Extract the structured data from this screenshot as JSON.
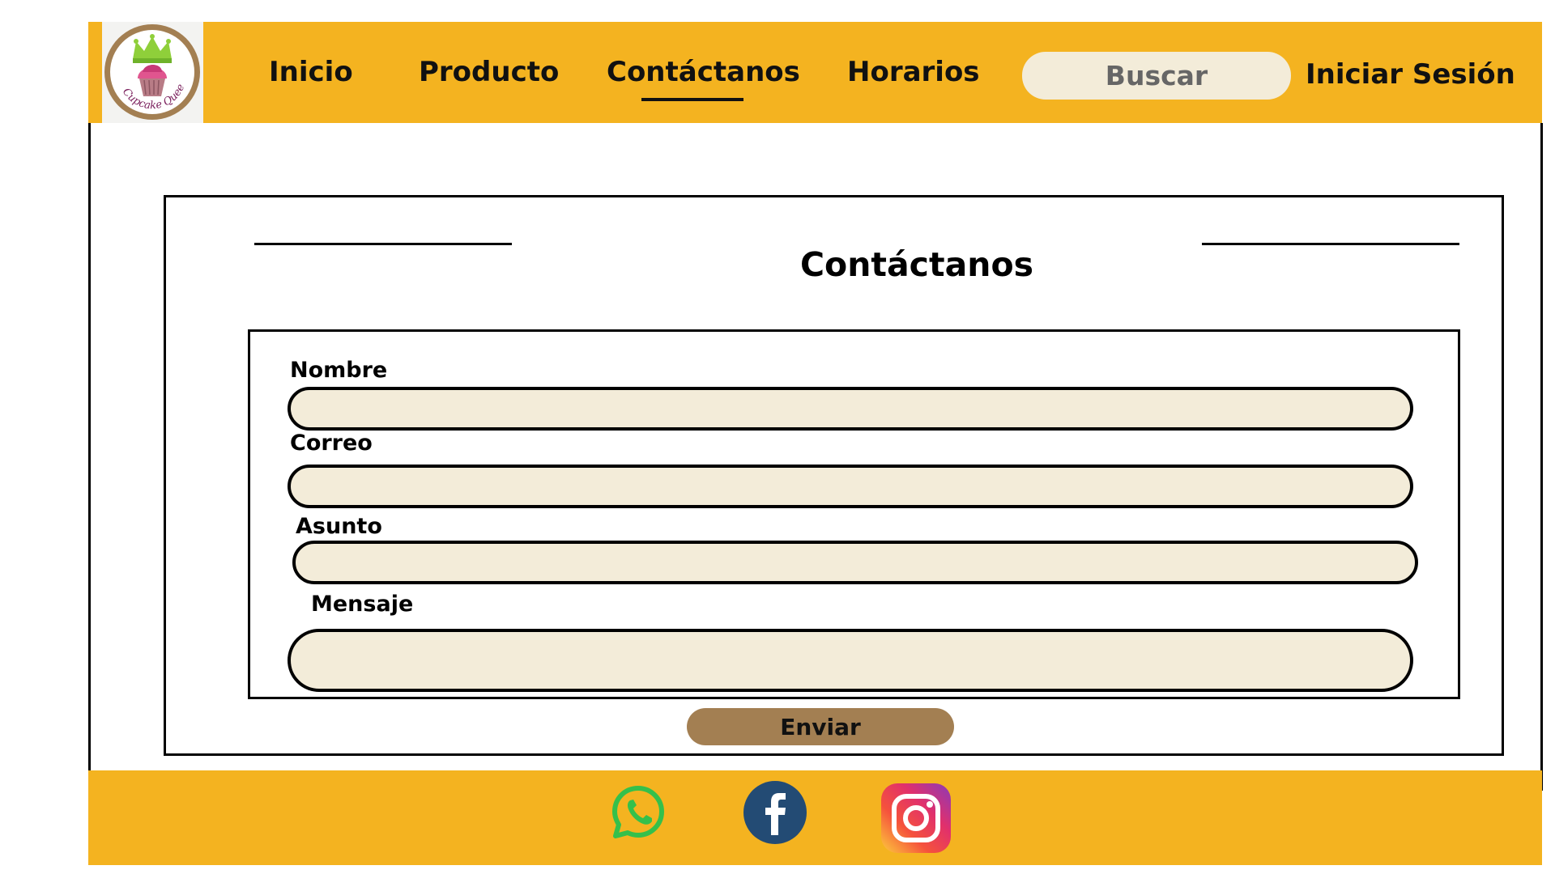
{
  "brand": {
    "logo_text": "Cupcake Queen"
  },
  "nav": {
    "items": [
      {
        "label": "Inicio"
      },
      {
        "label": "Producto"
      },
      {
        "label": "Contáctanos",
        "active": true
      },
      {
        "label": "Horarios"
      }
    ],
    "search_placeholder": "Buscar",
    "login_label": "Iniciar Sesión"
  },
  "contact": {
    "title": "Contáctanos",
    "fields": {
      "nombre": {
        "label": "Nombre",
        "value": ""
      },
      "correo": {
        "label": "Correo",
        "value": ""
      },
      "asunto": {
        "label": "Asunto",
        "value": ""
      },
      "mensaje": {
        "label": "Mensaje",
        "value": ""
      }
    },
    "submit_label": "Enviar"
  },
  "footer": {
    "social": [
      {
        "icon": "whatsapp-icon"
      },
      {
        "icon": "facebook-icon"
      },
      {
        "icon": "instagram-icon"
      }
    ]
  },
  "colors": {
    "header": "#f4b320",
    "field": "#f3ecd9",
    "button": "#a37f52"
  }
}
